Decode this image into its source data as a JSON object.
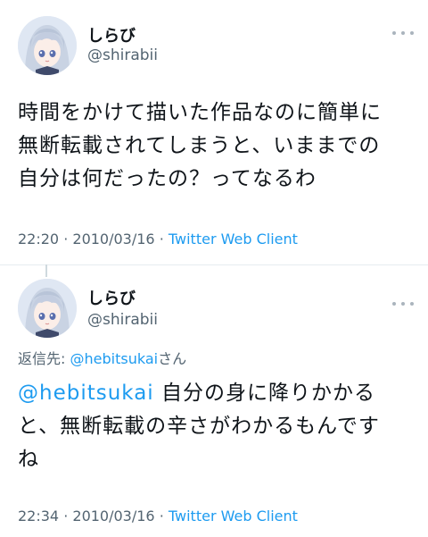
{
  "tweets": [
    {
      "display_name": "しらび",
      "handle": "@shirabii",
      "text_lines": [
        "時間をかけて描いた作品なのに簡単に",
        "無断転載されてしまうと、いままでの",
        "自分は何だったの？ってなるわ"
      ],
      "time": "22:20",
      "date": "2010/03/16",
      "separator": "·",
      "client": "Twitter Web Client"
    },
    {
      "display_name": "しらび",
      "handle": "@shirabii",
      "reply_label": "返信先:",
      "reply_mention": "@hebitsukai",
      "reply_suffix": "さん",
      "mention": "@hebitsukai",
      "text_line1_rest": " 自分の身に降りかかる",
      "text_lines_rest": [
        "と、無断転載の辛さがわかるもんです",
        "ね"
      ],
      "time": "22:34",
      "date": "2010/03/16",
      "separator": "·",
      "client": "Twitter Web Client"
    }
  ],
  "colors": {
    "link": "#1d9bf0",
    "secondary_text": "#536471",
    "primary_text": "#0f1419"
  },
  "icons": {
    "more": "more-horizontal-icon",
    "avatar": "avatar"
  }
}
